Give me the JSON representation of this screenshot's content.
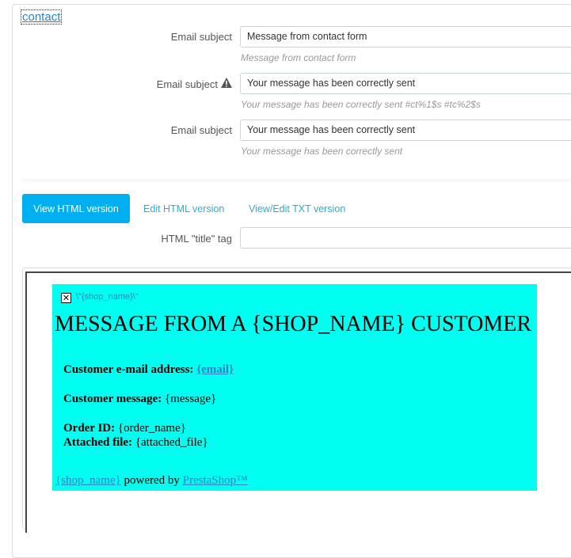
{
  "header": {
    "link": "contact"
  },
  "subjects": [
    {
      "label": "Email subject",
      "value": "Message from contact form",
      "hint": "Message from contact form",
      "warning": false
    },
    {
      "label": "Email subject",
      "value": "Your message has been correctly sent",
      "hint": "Your message has been correctly sent #ct%1$s #tc%2$s",
      "warning": true
    },
    {
      "label": "Email subject",
      "value": "Your message has been correctly sent",
      "hint": "Your message has been correctly sent",
      "warning": false
    }
  ],
  "tabs": [
    {
      "label": "View HTML version",
      "active": true
    },
    {
      "label": "Edit HTML version",
      "active": false
    },
    {
      "label": "View/Edit TXT version",
      "active": false
    }
  ],
  "title_tag": {
    "label": "HTML \"title\" tag",
    "value": ""
  },
  "preview": {
    "image_alt": "\\\"{shop_name}\\\"",
    "heading": "MESSAGE FROM A {SHOP_NAME} CUSTOMER",
    "email_label": "Customer e-mail address:",
    "email_value": "{email}",
    "message_label": "Customer message:",
    "message_value": "{message}",
    "order_label": "Order ID:",
    "order_value": "{order_name}",
    "file_label": "Attached file:",
    "file_value": "{attached_file}",
    "footer_shop": "{shop_name}",
    "footer_text": "powered by",
    "footer_brand": "PrestaShop™"
  },
  "colors": {
    "accent": "#00aff0",
    "link": "#2b84c6",
    "preview_bg": "#00fff0"
  },
  "icons": {
    "warning": "warning-icon",
    "broken_image": "broken-image-icon"
  }
}
